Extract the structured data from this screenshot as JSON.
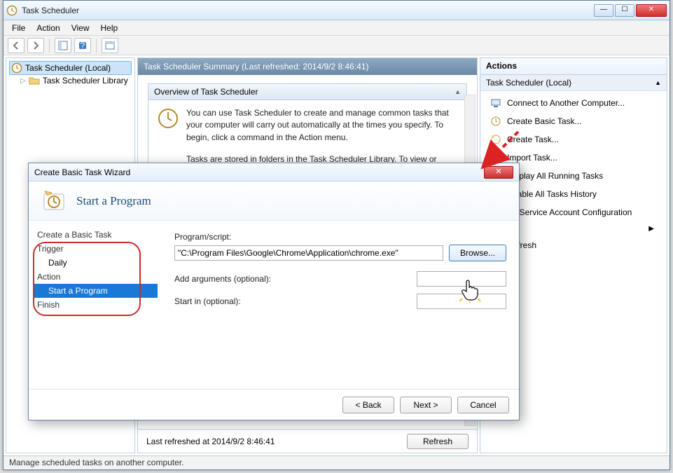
{
  "window": {
    "title": "Task Scheduler",
    "menus": {
      "file": "File",
      "action": "Action",
      "view": "View",
      "help": "Help"
    }
  },
  "tree": {
    "root": "Task Scheduler (Local)",
    "library": "Task Scheduler Library"
  },
  "summary": {
    "header": "Task Scheduler Summary (Last refreshed: 2014/9/2 8:46:41)",
    "overview_title": "Overview of Task Scheduler",
    "overview_p1": "You can use Task Scheduler to create and manage common tasks that your computer will carry out automatically at the times you specify. To begin, click a command in the Action menu.",
    "overview_p2": "Tasks are stored in folders in the Task Scheduler Library. To view or",
    "footer": "Last refreshed at 2014/9/2 8:46:41",
    "refresh": "Refresh"
  },
  "actions_panel": {
    "header": "Actions",
    "subheader": "Task Scheduler (Local)",
    "items": {
      "connect": "Connect to Another Computer...",
      "create_basic": "Create Basic Task...",
      "create_task": "Create Task...",
      "import": "Import Task...",
      "display_running": "Display All Running Tasks",
      "enable_history": "Enable All Tasks History",
      "at_service": "AT Service Account Configuration",
      "refresh": "Refresh"
    }
  },
  "wizard": {
    "title": "Create Basic Task Wizard",
    "heading": "Start a Program",
    "nav": {
      "create": "Create a Basic Task",
      "trigger": "Trigger",
      "daily": "Daily",
      "action": "Action",
      "start_program": "Start a Program",
      "finish": "Finish"
    },
    "form": {
      "program_label": "Program/script:",
      "program_value": "\"C:\\Program Files\\Google\\Chrome\\Application\\chrome.exe\"",
      "browse": "Browse...",
      "arguments_label": "Add arguments (optional):",
      "arguments_value": "",
      "startin_label": "Start in (optional):",
      "startin_value": ""
    },
    "buttons": {
      "back": "< Back",
      "next": "Next >",
      "cancel": "Cancel"
    }
  },
  "statusbar": "Manage scheduled tasks on another computer."
}
